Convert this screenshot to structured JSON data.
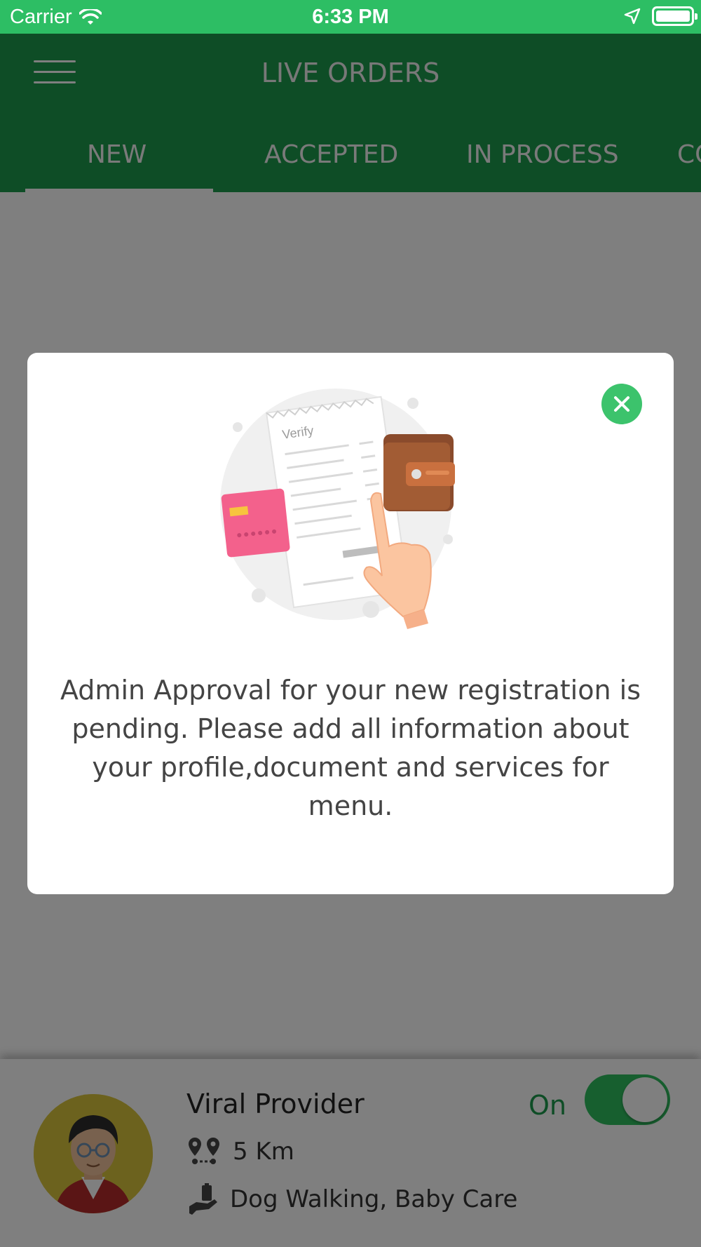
{
  "status_bar": {
    "carrier": "Carrier",
    "time": "6:33 PM"
  },
  "app_bar": {
    "title": "LIVE ORDERS",
    "tabs": [
      {
        "label": "NEW",
        "selected": true
      },
      {
        "label": "ACCEPTED",
        "selected": false
      },
      {
        "label": "IN PROCESS",
        "selected": false
      },
      {
        "label": "CO",
        "selected": false
      }
    ]
  },
  "dialog": {
    "illustration_text": "Verify",
    "message": "Admin Approval for your new registration is pending. Please add all information about your profile,document and services for menu."
  },
  "provider": {
    "name": "Viral Provider",
    "distance": "5 Km",
    "services": "Dog Walking, Baby Care",
    "status_label": "On",
    "online": true
  },
  "colors": {
    "status_bar": "#2dbe64",
    "app_bar": "#1c9a4d",
    "accent": "#2fbf5f",
    "overlay": "rgba(0,0,0,0.5)"
  },
  "icons": [
    "wifi-icon",
    "location-arrow-icon",
    "battery-icon",
    "menu-icon",
    "close-icon",
    "map-pins-icon",
    "service-hand-icon",
    "avatar"
  ]
}
